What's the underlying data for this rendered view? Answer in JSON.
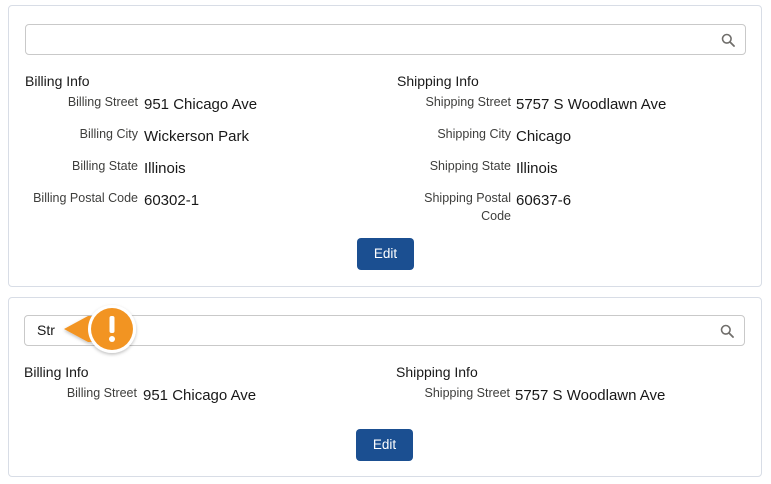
{
  "cards": [
    {
      "search": {
        "value": ""
      },
      "billing": {
        "title": "Billing Info",
        "street_label": "Billing Street",
        "street_value": "951 Chicago Ave",
        "city_label": "Billing City",
        "city_value": "Wickerson Park",
        "state_label": "Billing State",
        "state_value": "Illinois",
        "postal_label": "Billing Postal Code",
        "postal_value": "60302-1"
      },
      "shipping": {
        "title": "Shipping Info",
        "street_label": "Shipping Street",
        "street_value": "5757 S Woodlawn Ave",
        "city_label": "Shipping City",
        "city_value": "Chicago",
        "state_label": "Shipping State",
        "state_value": "Illinois",
        "postal_label_line1": "Shipping Postal",
        "postal_label_line2": "Code",
        "postal_value": "60637-6"
      },
      "edit_label": "Edit"
    },
    {
      "search": {
        "value": "Str"
      },
      "billing": {
        "title": "Billing Info",
        "street_label": "Billing Street",
        "street_value": "951 Chicago Ave"
      },
      "shipping": {
        "title": "Shipping Info",
        "street_label": "Shipping Street",
        "street_value": "5757 S Woodlawn Ave"
      },
      "edit_label": "Edit"
    }
  ],
  "callout": {
    "icon": "warning-exclamation-icon",
    "color": "#f29422"
  },
  "colors": {
    "button": "#1b4f91",
    "border": "#d8dde6"
  }
}
